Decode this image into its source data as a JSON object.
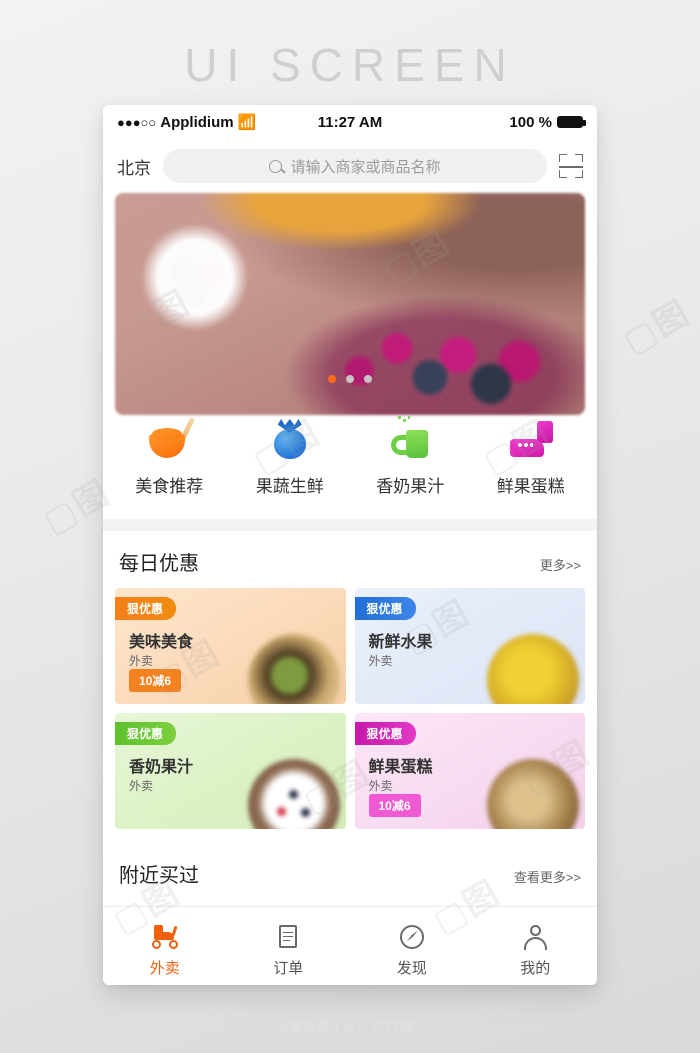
{
  "page": {
    "heading": "UI  SCREEN",
    "footer": "IBAOTU, COM"
  },
  "statusbar": {
    "signal_dots": "●●●○○",
    "carrier": "Applidium",
    "wifi_icon": "wifi-icon",
    "time": "11:27 AM",
    "battery_percent": "100 %",
    "battery_icon": "battery-full-icon"
  },
  "search": {
    "city": "北京",
    "placeholder": "请输入商家或商品名称",
    "search_icon": "search-icon",
    "scan_icon": "scan-code-icon"
  },
  "banner": {
    "dots_total": 3,
    "active_dot": 1,
    "active_color": "#ff6a12",
    "inactive_color": "#c9c4c4"
  },
  "categories": [
    {
      "label": "美食推荐",
      "icon": "noodle-bowl-icon",
      "color": "#f97b12"
    },
    {
      "label": "果蔬生鲜",
      "icon": "blueberry-icon",
      "color": "#1f6fd6"
    },
    {
      "label": "香奶果汁",
      "icon": "juice-cup-icon",
      "color": "#59c23b"
    },
    {
      "label": "鲜果蛋糕",
      "icon": "cake-icon",
      "color": "#cf17a8"
    }
  ],
  "deals_section": {
    "title": "每日优惠",
    "more": "更多>>",
    "cards": [
      {
        "ribbon": "狠优惠",
        "title": "美味美食",
        "subtitle": "外卖",
        "tag": "10减6",
        "accent": "#f57f1a"
      },
      {
        "ribbon": "狠优惠",
        "title": "新鲜水果",
        "subtitle": "外卖",
        "tag": "",
        "accent": "#1f6fd6"
      },
      {
        "ribbon": "狠优惠",
        "title": "香奶果汁",
        "subtitle": "外卖",
        "tag": "",
        "accent": "#5ec12e"
      },
      {
        "ribbon": "狠优惠",
        "title": "鲜果蛋糕",
        "subtitle": "外卖",
        "tag": "10减6",
        "accent": "#c618a9"
      }
    ]
  },
  "nearby_section": {
    "title": "附近买过",
    "more": "查看更多>>"
  },
  "tabbar": [
    {
      "label": "外卖",
      "icon": "scooter-icon",
      "active": true
    },
    {
      "label": "订单",
      "icon": "document-icon",
      "active": false
    },
    {
      "label": "发现",
      "icon": "compass-icon",
      "active": false
    },
    {
      "label": "我的",
      "icon": "person-icon",
      "active": false
    }
  ]
}
